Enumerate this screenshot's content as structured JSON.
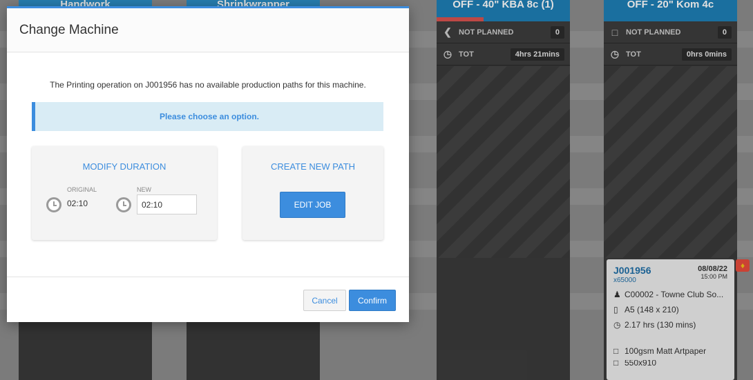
{
  "board": {
    "lanes": [
      {
        "title": "Handwork"
      },
      {
        "title": "Shrinkwrapper"
      },
      {
        "title": "OFF - 40\" KBA 8c (1)",
        "not_planned_label": "NOT PLANNED",
        "not_planned_count": "0",
        "tot_label": "TOT",
        "tot_value": "4hrs 21mins"
      },
      {
        "title": "OFF - 20\" Kom 4c",
        "not_planned_label": "NOT PLANNED",
        "not_planned_count": "0",
        "tot_label": "TOT",
        "tot_value": "0hrs 0mins"
      }
    ],
    "card": {
      "job_id": "J001956",
      "quantity": "x65000",
      "date": "08/08/22",
      "time": "15:00 PM",
      "customer": "C00002 - Towne Club So...",
      "size": "A5 (148 x 210)",
      "duration": "2.17 hrs (130 mins)",
      "paper": "100gsm Matt Artpaper",
      "cut_text": "550x910"
    }
  },
  "modal": {
    "title": "Change Machine",
    "message": "The Printing operation on J001956 has no available production paths for this machine.",
    "alert": "Please choose an option.",
    "modify": {
      "title": "MODIFY DURATION",
      "original_label": "ORIGINAL",
      "original_value": "02:10",
      "new_label": "NEW",
      "new_value": "02:10"
    },
    "create": {
      "title": "CREATE NEW PATH",
      "button": "EDIT JOB"
    },
    "cancel_label": "Cancel",
    "confirm_label": "Confirm"
  },
  "colors": {
    "accent": "#3c8dde",
    "lane_header": "#1e7fb5",
    "alert_bg": "#d9ecf5"
  }
}
